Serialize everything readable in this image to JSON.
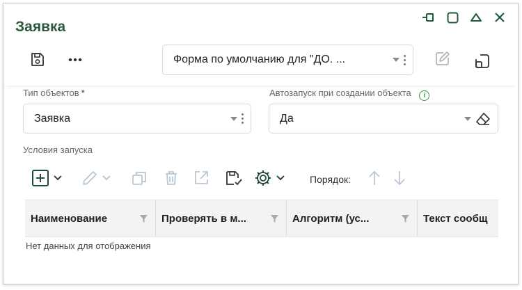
{
  "window": {
    "title": "Заявка",
    "controls": [
      "pin-icon",
      "maximize-icon",
      "collapse-icon",
      "close-icon"
    ]
  },
  "toolbar": {
    "icons": [
      "save-icon",
      "more-icon"
    ],
    "form_select": {
      "value": "Форма по умолчанию для \"ДО. ..."
    },
    "right_icons": [
      "edit-icon",
      "layout-icon"
    ]
  },
  "fields": {
    "object_type": {
      "label": "Тип объектов",
      "required_mark": "*",
      "value": "Заявка"
    },
    "autostart": {
      "label": "Автозапуск при создании объекта",
      "value": "Да"
    }
  },
  "conditions": {
    "label": "Условия запуска",
    "toolbar_icons": [
      "add-icon",
      "edit-icon",
      "copy-icon",
      "delete-icon",
      "open-icon",
      "save-icon",
      "settings-icon"
    ],
    "order_label": "Порядок:"
  },
  "grid": {
    "columns": [
      "Наименование",
      "Проверять в м...",
      "Алгоритм (ус...",
      "Текст сообщ"
    ],
    "empty_text": "Нет данных для отображения"
  },
  "colors": {
    "title": "#2d5a3c",
    "accent_icon": "#1f5a3a",
    "disabled_icon": "#b8c7d6",
    "info_green": "#2f9a3a"
  }
}
